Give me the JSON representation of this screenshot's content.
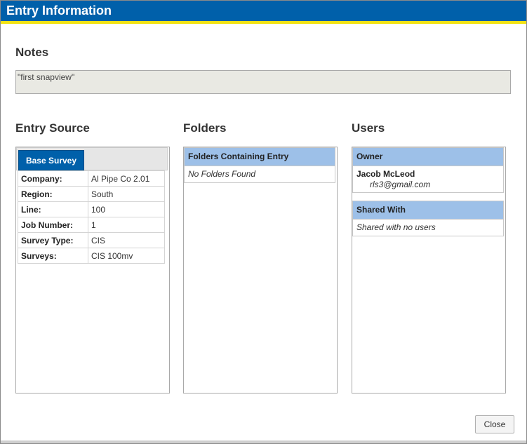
{
  "dialog": {
    "title": "Entry Information",
    "close_label": "Close"
  },
  "notes": {
    "heading": "Notes",
    "text": "\"first snapview\""
  },
  "entry_source": {
    "heading": "Entry Source",
    "tab_label": "Base Survey",
    "rows": [
      {
        "label": "Company:",
        "value": "Al Pipe Co 2.01"
      },
      {
        "label": "Region:",
        "value": "South"
      },
      {
        "label": "Line:",
        "value": "100"
      },
      {
        "label": "Job Number:",
        "value": "1"
      },
      {
        "label": "Survey Type:",
        "value": "CIS"
      },
      {
        "label": "Surveys:",
        "value": "CIS 100mv"
      }
    ]
  },
  "folders": {
    "heading": "Folders",
    "table_header": "Folders Containing Entry",
    "empty_text": "No Folders Found"
  },
  "users": {
    "heading": "Users",
    "owner_header": "Owner",
    "owner_name": "Jacob McLeod",
    "owner_email": "rls3@gmail.com",
    "shared_header": "Shared With",
    "shared_empty": "Shared with no users"
  }
}
